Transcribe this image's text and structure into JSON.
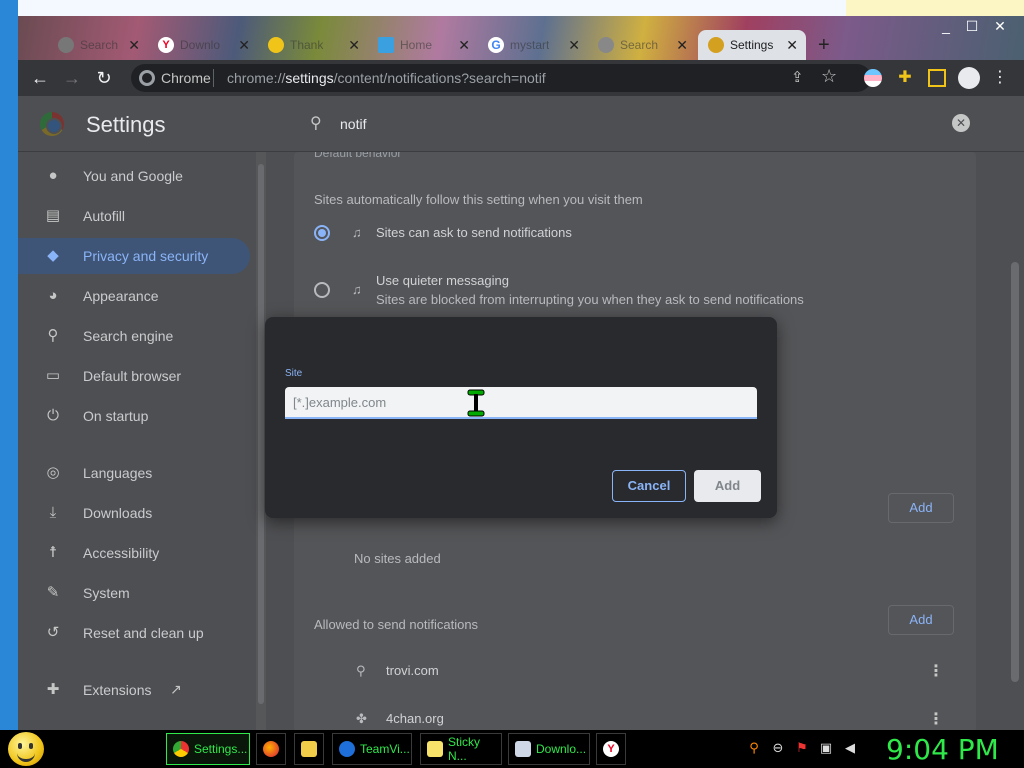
{
  "window": {
    "controls": [
      "_",
      "☐",
      "✕"
    ],
    "tabs": [
      {
        "label": "Search",
        "icon": "search-icon"
      },
      {
        "label": "Downlo",
        "icon": "yandex-icon"
      },
      {
        "label": "Thank",
        "icon": "smiley-icon"
      },
      {
        "label": "Home",
        "icon": "home-icon"
      },
      {
        "label": "mystart",
        "icon": "google-icon"
      },
      {
        "label": "Search",
        "icon": "search-icon"
      },
      {
        "label": "Settings",
        "icon": "gear-icon"
      }
    ],
    "new_tab": "+"
  },
  "toolbar": {
    "site_name": "Chrome",
    "url_prefix": "chrome://",
    "url_host": "settings",
    "url_path": "/content/notifications?search=notif"
  },
  "settings": {
    "title": "Settings",
    "search_value": "notif",
    "nav": [
      {
        "label": "You and Google",
        "icon": "person-icon"
      },
      {
        "label": "Autofill",
        "icon": "clipboard-icon"
      },
      {
        "label": "Privacy and security",
        "icon": "shield-icon"
      },
      {
        "label": "Appearance",
        "icon": "palette-icon"
      },
      {
        "label": "Search engine",
        "icon": "search-icon"
      },
      {
        "label": "Default browser",
        "icon": "browser-icon"
      },
      {
        "label": "On startup",
        "icon": "power-icon"
      },
      {
        "label": "Languages",
        "icon": "globe-icon"
      },
      {
        "label": "Downloads",
        "icon": "download-icon"
      },
      {
        "label": "Accessibility",
        "icon": "accessibility-icon"
      },
      {
        "label": "System",
        "icon": "wrench-icon"
      },
      {
        "label": "Reset and clean up",
        "icon": "reset-icon"
      },
      {
        "label": "Extensions",
        "icon": "puzzle-icon"
      }
    ],
    "content": {
      "section_heading": "Default behavior",
      "section_desc": "Sites automatically follow this setting when you visit them",
      "option_ask": "Sites can ask to send notifications",
      "option_quiet": "Use quieter messaging",
      "option_quiet_desc": "Sites are blocked from interrupting you when they ask to send notifications",
      "no_sites": "No sites added",
      "allowed_heading": "Allowed to send notifications",
      "add_label": "Add",
      "allowed_sites": [
        "trovi.com",
        "4chan.org"
      ]
    }
  },
  "dialog": {
    "field_label": "Site",
    "placeholder": "[*.]example.com",
    "cancel_label": "Cancel",
    "add_label": "Add"
  },
  "taskbar": {
    "items": [
      {
        "label": "Settings...",
        "icon": "chrome-icon"
      },
      {
        "label": "",
        "icon": "firefox-icon"
      },
      {
        "label": "",
        "icon": "folder-icon"
      },
      {
        "label": "TeamVi...",
        "icon": "teamviewer-icon"
      },
      {
        "label": "Sticky N...",
        "icon": "sticky-notes-icon"
      },
      {
        "label": "Downlo...",
        "icon": "downloads-icon"
      },
      {
        "label": "",
        "icon": "yandex-icon"
      }
    ],
    "clock": "9:04 PM"
  },
  "colors": {
    "accent": "#8ab4f8",
    "taskbar_text": "#2fe84a",
    "nav_active_bg": "#3f5577"
  }
}
